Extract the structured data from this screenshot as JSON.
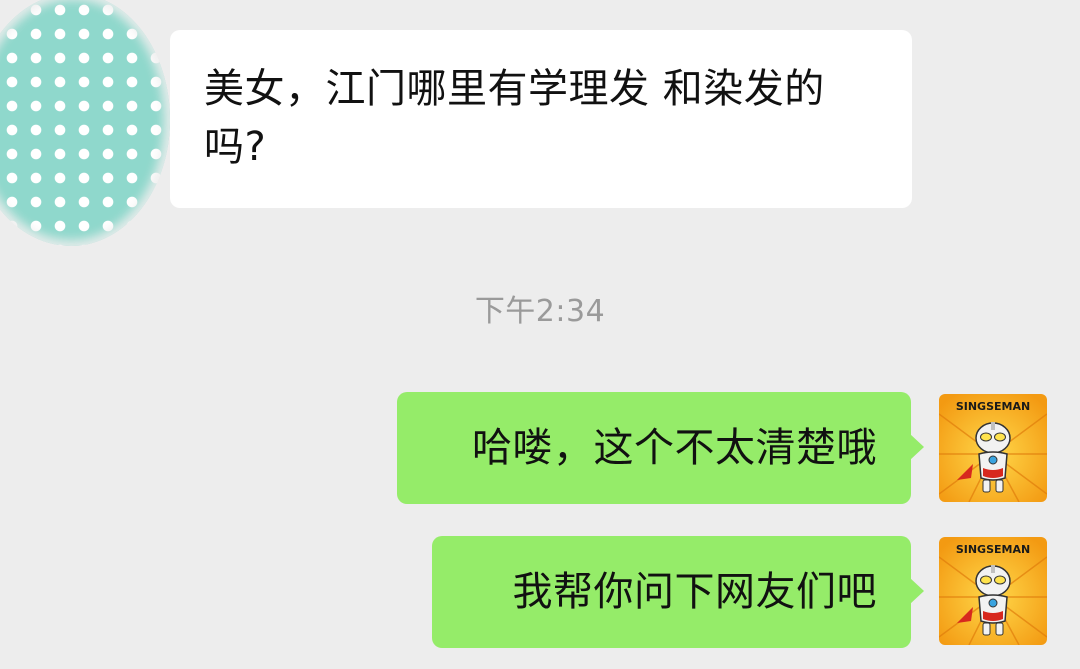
{
  "chat": {
    "incoming": {
      "text": "美女，江门哪里有学理发 和染发的吗?"
    },
    "timestamp": "下午2:34",
    "outgoing": [
      {
        "text": "哈喽，这个不太清楚哦"
      },
      {
        "text": "我帮你问下网友们吧"
      }
    ],
    "self_avatar_label": "SINGSEMAN"
  },
  "colors": {
    "background": "#ededed",
    "incoming_bubble": "#ffffff",
    "outgoing_bubble": "#95ec69",
    "timestamp_text": "#9a9a9a",
    "contact_avatar": "#8fd8cc",
    "self_avatar_bg": "#f7b21b"
  },
  "icons": {
    "contact_avatar": "polka-dot-avatar",
    "self_avatar": "ultraman-sticker-avatar"
  }
}
